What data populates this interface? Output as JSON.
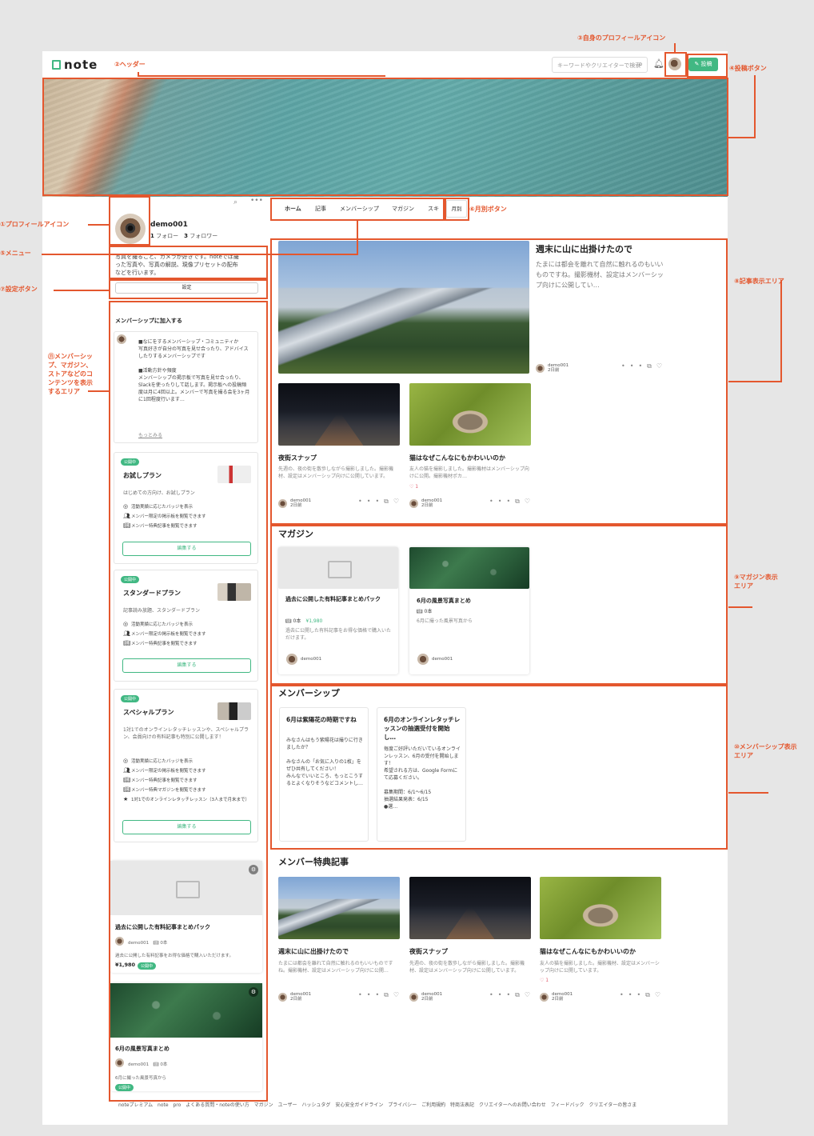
{
  "header": {
    "logo": "note",
    "search_placeholder": "キーワードやクリエイターで検索",
    "post_label": "投稿"
  },
  "profile": {
    "username": "demo001",
    "follow_count": "1",
    "follow_label": "フォロー",
    "follower_count": "3",
    "follower_label": "フォロワー",
    "bio": "写真を撮ること、カメラが好きです。noteでは撮った写真や、写真の解説、現像プリセットの配布などを行います。",
    "settings_label": "設定"
  },
  "membership_join": {
    "title": "メンバーシップに加入する",
    "description": "■なにをするメンバーシップ・コミュニティか\n写真好きが自分の写真を見せ合ったり、アドバイスしたりするメンバーシップです\n\n■活動方針や頻度\nメンバーシップの掲示板で写真を見せ合ったり、Slackを使ったりして話します。掲示板への投稿頻度は月に4回以上。メンバーで写真を撮る会を3ヶ月に1回程度行います…",
    "more_label": "もっとみる"
  },
  "plans": [
    {
      "badge": "公開中",
      "name": "お試しプラン",
      "description": "はじめての方向け、お試しプラン",
      "features": [
        "活動実績に応じたバッジを表示",
        "メンバー限定の掲示板を閲覧できます",
        "メンバー特典記事を閲覧できます"
      ],
      "edit_label": "編集する"
    },
    {
      "badge": "公開中",
      "name": "スタンダードプラン",
      "description": "記事読み放題、スタンダードプラン",
      "features": [
        "活動実績に応じたバッジを表示",
        "メンバー限定の掲示板を閲覧できます",
        "メンバー特典記事を閲覧できます"
      ],
      "edit_label": "編集する"
    },
    {
      "badge": "公開中",
      "name": "スペシャルプラン",
      "description": "1対1でのオンラインレタッチレッスンや、スペシャルプラン、会員向けの有料記事も特別に公開します！",
      "features": [
        "活動実績に応じたバッジを表示",
        "メンバー限定の掲示板を閲覧できます",
        "メンバー特典記事を閲覧できます",
        "メンバー特典マガジンを閲覧できます",
        "1対1でのオンラインレタッチレッスン（3人まで月末まで）"
      ],
      "edit_label": "編集する"
    }
  ],
  "side_magazines": [
    {
      "title": "過去に公開した有料記事まとめパック",
      "author": "demo001",
      "count": "0本",
      "description": "過去に公開した有料記事をお得な価格で購入いただけます。",
      "price": "¥1,980",
      "badge": "公開中"
    },
    {
      "title": "6月の風景写真まとめ",
      "author": "demo001",
      "count": "0本",
      "description": "6月に撮った風景写真から",
      "badge": "公開中"
    }
  ],
  "tabs": [
    "ホーム",
    "記事",
    "メンバーシップ",
    "マガジン",
    "スキ"
  ],
  "month_tab": "月別",
  "articles": {
    "featured": {
      "title": "週末に山に出掛けたので",
      "description": "たまには都会を離れて自然に触れるのもいいものですね。撮影機材、設定はメンバーシップ向けに公開してい…",
      "author": "demo001",
      "time": "2日前"
    },
    "items": [
      {
        "title": "夜街スナップ",
        "description": "先週の、夜の街を散歩しながら撮影しました。撮影機材、設定はメンバーシップ向けに公開しています。",
        "author": "demo001",
        "time": "2日前"
      },
      {
        "title": "猫はなぜこんなにもかわいいのか",
        "description": "友人の猫を撮影しました。撮影機材はメンバーシップ向けに公開。撮影機材ポカ…",
        "author": "demo001",
        "time": "2日前",
        "likes": "1"
      }
    ]
  },
  "magazine_section": {
    "title": "マガジン",
    "cards": [
      {
        "title": "過去に公開した有料記事まとめパック",
        "count": "0本",
        "price": "¥1,980",
        "description": "過去に公開した有料記事をお得な価格で購入いただけます。",
        "author": "demo001"
      },
      {
        "title": "6月の風景写真まとめ",
        "count": "0本",
        "description": "6月に撮った風景写真から",
        "author": "demo001"
      }
    ]
  },
  "membership_section": {
    "title": "メンバーシップ",
    "posts": [
      {
        "title": "6月は紫陽花の時期ですね",
        "body": "みなさんはもう紫陽花は撮りに行きましたか？\n\nみなさんの「お気に入りの1枚」をぜひ共有してください！\nみんなでいいところ、もっとこうするとよくなりそうなどコメントし…"
      },
      {
        "title": "6月のオンラインレタッチレッスンの抽選受付を開始し…",
        "body": "毎度ご好評いただいているオンラインレッスン、6月の受付を開始します！\n希望される方は、Google Formにて応募ください。\n\n募集期間：6/1〜6/15\n抽選結果発表：6/15\n●選…"
      }
    ]
  },
  "benefit_section": {
    "title": "メンバー特典記事",
    "items": [
      {
        "title": "週末に山に出掛けたので",
        "description": "たまには都会を離れて自然に触れるのもいいものですね。撮影機材、設定はメンバーシップ向けに公開…",
        "author": "demo001",
        "time": "2日前"
      },
      {
        "title": "夜街スナップ",
        "description": "先週の、夜の街を散歩しながら撮影しました。撮影機材、設定はメンバーシップ向けに公開しています。",
        "author": "demo001",
        "time": "2日前"
      },
      {
        "title": "猫はなぜこんなにもかわいいのか",
        "description": "友人の猫を撮影しました。撮影機材、設定はメンバーシップ向けに公開しています。",
        "author": "demo001",
        "time": "2日前",
        "likes": "1"
      }
    ]
  },
  "footer": [
    "noteプレミアム",
    "note pro",
    "よくある質問・noteの使い方",
    "マガジン",
    "ユーザー",
    "ハッシュタグ",
    "安心安全ガイドライン",
    "プライバシー",
    "ご利用規約",
    "特商法表記",
    "クリエイターへのお問い合わせ",
    "フィードバック",
    "クリエイターの皆さま"
  ],
  "annotations": {
    "a1": "①プロフィールアイコン",
    "a2": "②ヘッダー",
    "a3": "③自身のプロフィールアイコン",
    "a4": "④投稿ボタン",
    "a5": "⑤メニュー",
    "a6": "⑥月別ボタン",
    "a7": "⑦設定ボタン",
    "a8": "⑧記事表示エリア",
    "a9": "⑨マガジン表示エリア",
    "a10": "⑩メンバーシップ表示エリア",
    "a11": "⑪メンバーシップ、マガジン、ストアなどのコンテンツを表示するエリア"
  },
  "colors": {
    "accent": "#41b883",
    "annotation": "#e4572e"
  }
}
